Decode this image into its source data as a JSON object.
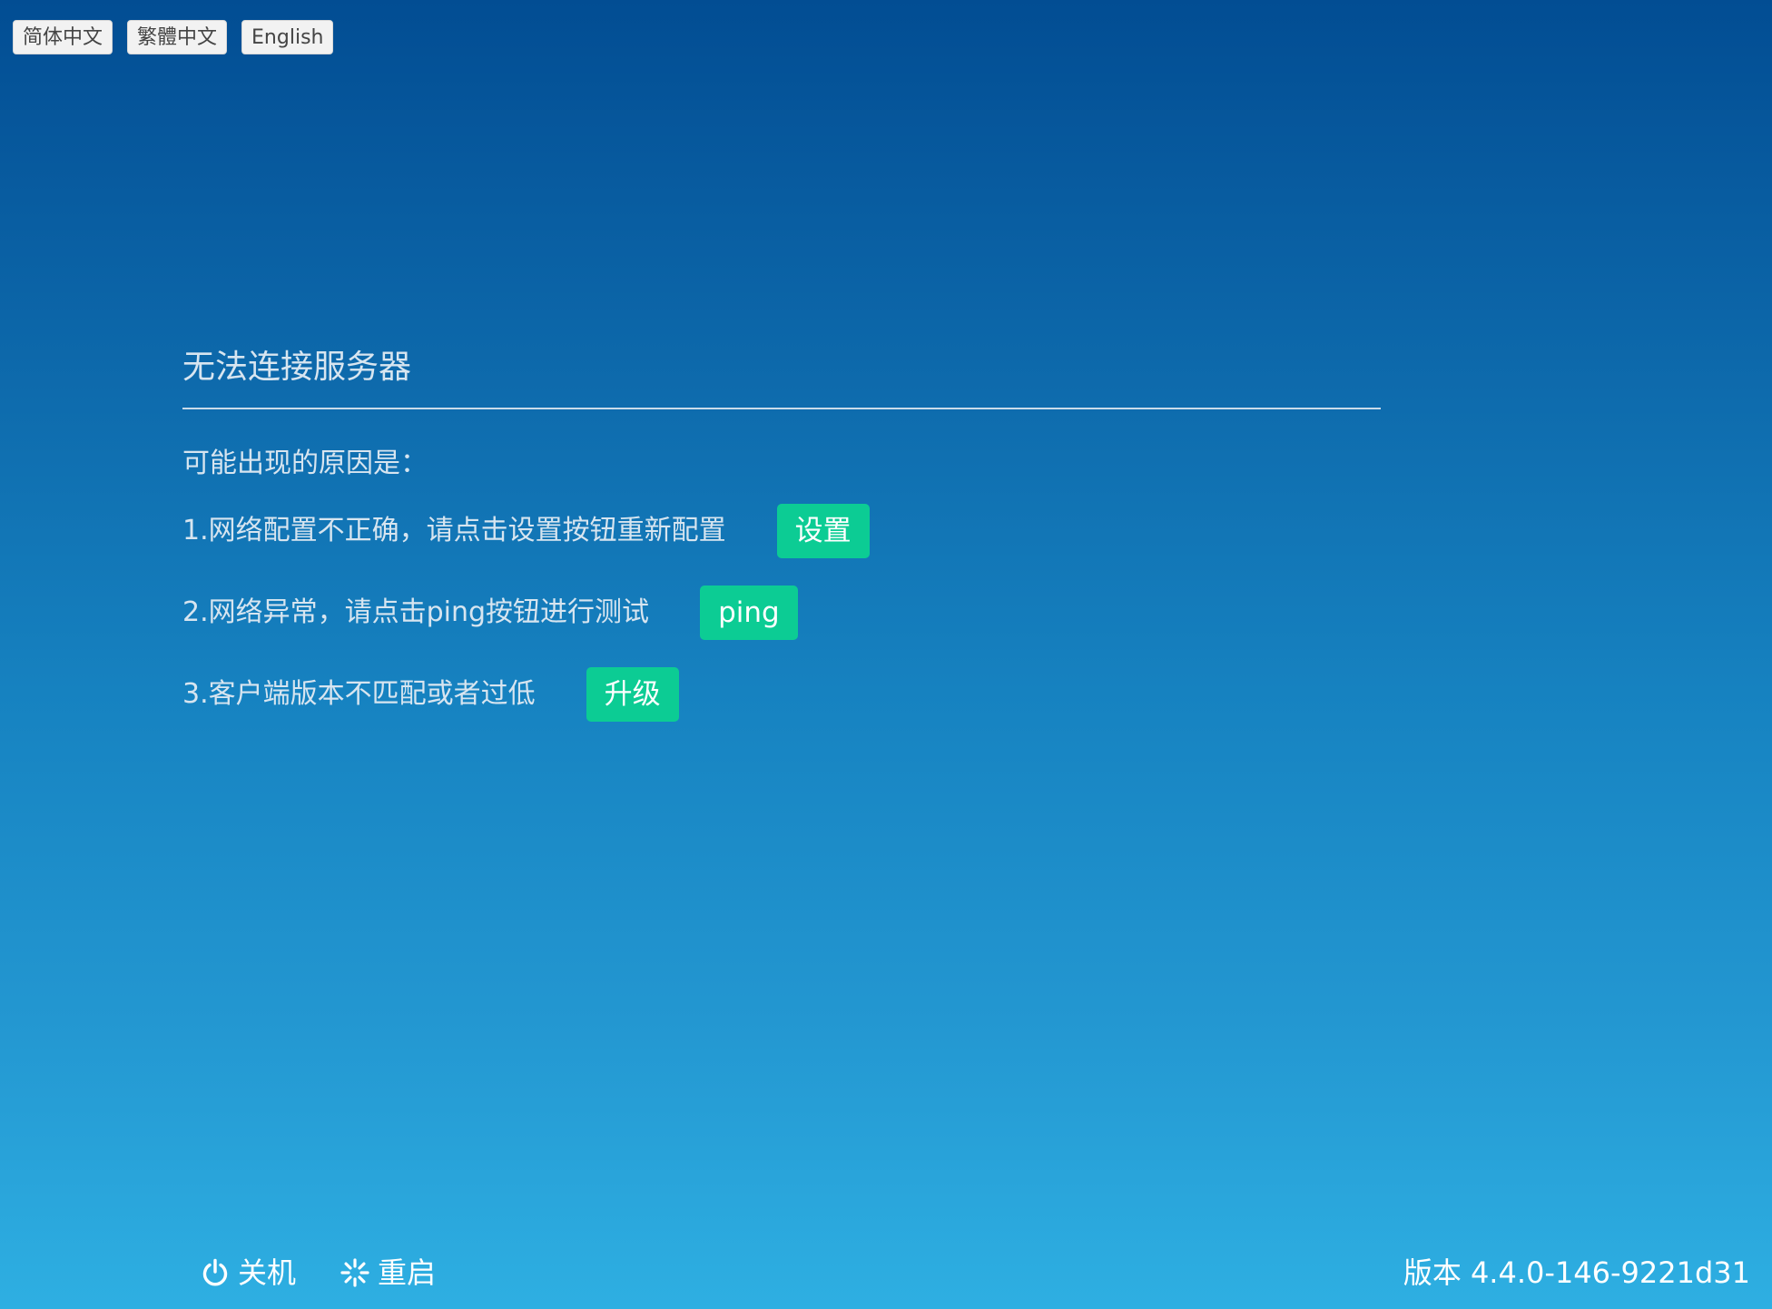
{
  "languages": {
    "simplified": "简体中文",
    "traditional": "繁體中文",
    "english": "English"
  },
  "main": {
    "title": "无法连接服务器",
    "reasons_label": "可能出现的原因是：",
    "reasons": [
      {
        "text": "1.网络配置不正确，请点击设置按钮重新配置",
        "button": "设置"
      },
      {
        "text": "2.网络异常，请点击ping按钮进行测试",
        "button": "ping"
      },
      {
        "text": "3.客户端版本不匹配或者过低",
        "button": "升级"
      }
    ]
  },
  "footer": {
    "shutdown_label": "关机",
    "shutdown_icon": "power-icon",
    "restart_label": "重启",
    "restart_icon": "loading-spinner-icon",
    "version_label": "版本",
    "version_value": "4.4.0-146-9221d31"
  },
  "colors": {
    "accent_button": "#0ccc94",
    "background_top": "#024d93",
    "background_bottom": "#2eafe2"
  }
}
